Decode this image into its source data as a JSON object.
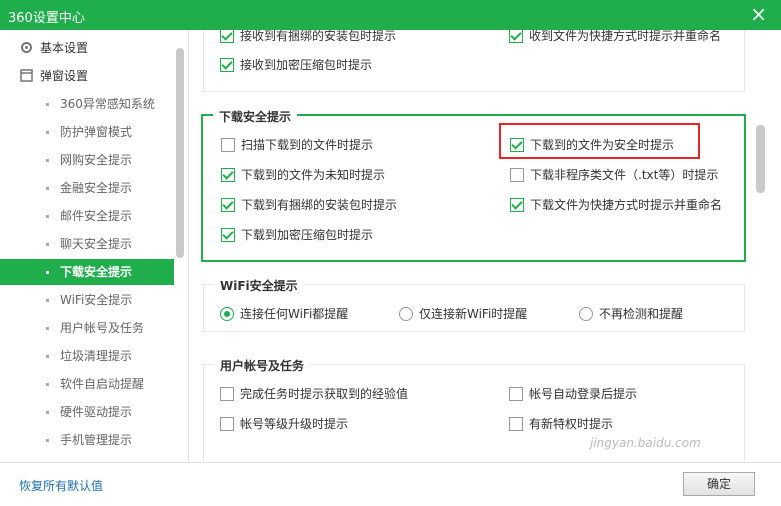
{
  "window": {
    "title": "360设置中心",
    "close": "×"
  },
  "sidebar": {
    "items": [
      {
        "label": "基本设置",
        "type": "top",
        "icon": "gear-icon"
      },
      {
        "label": "弹窗设置",
        "type": "top",
        "icon": "window-icon"
      },
      {
        "label": "360异常感知系统",
        "type": "sub"
      },
      {
        "label": "防护弹窗模式",
        "type": "sub"
      },
      {
        "label": "网购安全提示",
        "type": "sub"
      },
      {
        "label": "金融安全提示",
        "type": "sub"
      },
      {
        "label": "邮件安全提示",
        "type": "sub"
      },
      {
        "label": "聊天安全提示",
        "type": "sub"
      },
      {
        "label": "下载安全提示",
        "type": "sub",
        "active": true
      },
      {
        "label": "WiFi安全提示",
        "type": "sub"
      },
      {
        "label": "用户帐号及任务",
        "type": "sub"
      },
      {
        "label": "垃圾清理提示",
        "type": "sub"
      },
      {
        "label": "软件自启动提醒",
        "type": "sub"
      },
      {
        "label": "硬件驱动提示",
        "type": "sub"
      },
      {
        "label": "手机管理提示",
        "type": "sub"
      }
    ]
  },
  "prev_section": {
    "options": [
      {
        "label": "接收到有捆绑的安装包时提示",
        "checked": true
      },
      {
        "label": "收到文件为快捷方式时提示并重命名",
        "checked": true
      },
      {
        "label": "接收到加密压缩包时提示",
        "checked": true
      }
    ]
  },
  "download_section": {
    "title": "下载安全提示",
    "options": [
      {
        "label": "扫描下载到的文件时提示",
        "checked": false
      },
      {
        "label": "下载到的文件为安全时提示",
        "checked": true
      },
      {
        "label": "下载到的文件为未知时提示",
        "checked": true
      },
      {
        "label": "下载非程序类文件（.txt等）时提示",
        "checked": false
      },
      {
        "label": "下载到有捆绑的安装包时提示",
        "checked": true
      },
      {
        "label": "下载文件为快捷方式时提示并重命名",
        "checked": true
      },
      {
        "label": "下载到加密压缩包时提示",
        "checked": true
      }
    ]
  },
  "wifi_section": {
    "title": "WiFi安全提示",
    "options": [
      {
        "label": "连接任何WiFi都提醒",
        "selected": true
      },
      {
        "label": "仅连接新WiFi时提醒",
        "selected": false
      },
      {
        "label": "不再检测和提醒",
        "selected": false
      }
    ]
  },
  "account_section": {
    "title": "用户帐号及任务",
    "options": [
      {
        "label": "完成任务时提示获取到的经验值",
        "checked": false
      },
      {
        "label": "帐号自动登录后提示",
        "checked": false
      },
      {
        "label": "帐号等级升级时提示",
        "checked": false
      },
      {
        "label": "有新特权时提示",
        "checked": false
      }
    ]
  },
  "footer": {
    "restore": "恢复所有默认值",
    "ok": "确定"
  },
  "watermark": "jingyan.baidu.com",
  "colors": {
    "brand": "#1fae4b",
    "highlight": "#e5262d"
  }
}
